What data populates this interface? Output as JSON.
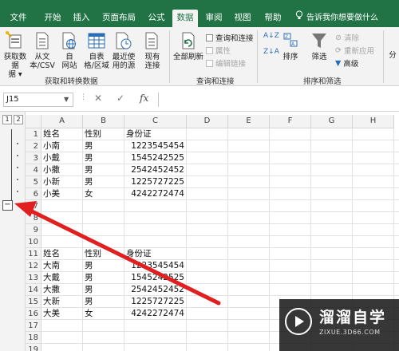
{
  "ribbon_tabs": [
    "文件",
    "开始",
    "插入",
    "页面布局",
    "公式",
    "数据",
    "审阅",
    "视图",
    "帮助"
  ],
  "active_tab": "数据",
  "tell_me": "告诉我你想要做什么",
  "groups": {
    "get_transform": {
      "label": "获取和转换数据",
      "get_data": "获取数据",
      "get_data_sub": "据 ▾",
      "from_text": "从文",
      "from_text_sub": "本/CSV",
      "from_web": "自",
      "from_web_sub": "网站",
      "from_table": "自表",
      "from_table_sub": "格/区域",
      "recent_sources": "最近使",
      "recent_sources_sub": "用的源",
      "existing_connections": "现有",
      "existing_connections_sub": "连接"
    },
    "queries": {
      "label": "查询和连接",
      "refresh_all": "全部刷新",
      "queries_connections": "查询和连接",
      "properties": "属性",
      "edit_links": "编辑链接"
    },
    "sort_filter": {
      "label": "排序和筛选",
      "sort": "排序",
      "filter": "筛选",
      "clear": "清除",
      "reapply": "重新应用",
      "advanced": "高级"
    },
    "data_tools": {
      "partial_label": "分"
    }
  },
  "formula_bar": {
    "name_box": "J15",
    "cancel": "✕",
    "enter": "✓",
    "fx": "fx",
    "value": ""
  },
  "outline": {
    "levels": [
      "1",
      "2"
    ],
    "collapse_button": "−"
  },
  "columns": [
    "A",
    "B",
    "C",
    "D",
    "E",
    "F",
    "G",
    "H"
  ],
  "rows": [
    "1",
    "2",
    "3",
    "4",
    "5",
    "6",
    "7",
    "8",
    "9",
    "10",
    "11",
    "12",
    "13",
    "14",
    "15",
    "16",
    "17",
    "18",
    "19"
  ],
  "table1": {
    "headers": [
      "姓名",
      "性别",
      "身份证"
    ],
    "rows": [
      [
        "小南",
        "男",
        "1223545454"
      ],
      [
        "小戴",
        "男",
        "1545242525"
      ],
      [
        "小撒",
        "男",
        "2542452452"
      ],
      [
        "小新",
        "男",
        "1225727225"
      ],
      [
        "小美",
        "女",
        "4242272474"
      ]
    ]
  },
  "table2": {
    "headers": [
      "姓名",
      "性别",
      "身份证"
    ],
    "rows": [
      [
        "大南",
        "男",
        "1223545454"
      ],
      [
        "大戴",
        "男",
        "1545242525"
      ],
      [
        "大撒",
        "男",
        "2542452452"
      ],
      [
        "大新",
        "男",
        "1225727225"
      ],
      [
        "大美",
        "女",
        "4242272474"
      ]
    ]
  },
  "watermark": {
    "title": "溜溜自学",
    "subtitle": "ZIXUE.3D66.COM"
  },
  "colors": {
    "excel_green": "#217346",
    "arrow_red": "#e02020"
  }
}
